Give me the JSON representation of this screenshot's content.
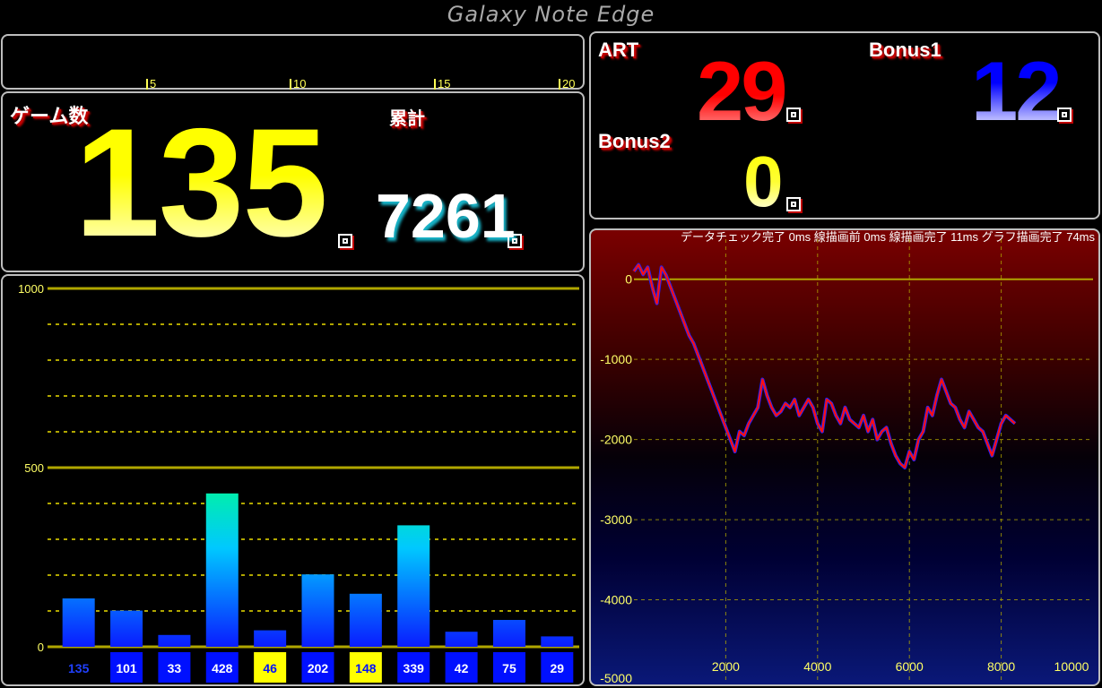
{
  "window": {
    "title": "Galaxy Note Edge"
  },
  "ruler": {
    "ticks": [
      "5",
      "10",
      "15",
      "20"
    ]
  },
  "game": {
    "count_label": "ゲーム数",
    "count_value": "135",
    "total_label": "累計",
    "total_value": "7261",
    "unit_icon": "square-spiral-icon"
  },
  "bonus": {
    "art_label": "ART",
    "art_value": "29",
    "bonus1_label": "Bonus1",
    "bonus1_value": "12",
    "bonus2_label": "Bonus2",
    "bonus2_value": "0"
  },
  "status": {
    "text": "データチェック完了 0ms  線描画前 0ms  線描画完了 11ms  グラフ描画完了 74ms"
  },
  "colors": {
    "blue_bar": "#0a32ff",
    "yellow_bar": "#ffff00",
    "grid": "#b0a600",
    "line_red": "#ff1010",
    "line_blue": "#1a20ff",
    "label_red": "#c00000"
  },
  "chart_data": [
    {
      "type": "bar",
      "categories": [
        "135",
        "101",
        "33",
        "428",
        "46",
        "202",
        "148",
        "339",
        "42",
        "75",
        "29"
      ],
      "values": [
        135,
        101,
        33,
        428,
        46,
        202,
        148,
        339,
        42,
        75,
        29
      ],
      "highlight": [
        false,
        false,
        false,
        false,
        true,
        false,
        true,
        false,
        false,
        false,
        false
      ],
      "yticks": [
        "0",
        "500",
        "1000"
      ],
      "ylim": [
        0,
        1000
      ],
      "grid": true
    },
    {
      "type": "line",
      "x": [
        0,
        100,
        200,
        300,
        400,
        500,
        600,
        700,
        800,
        900,
        1000,
        1100,
        1200,
        1300,
        1400,
        1500,
        1600,
        1700,
        1800,
        1900,
        2000,
        2100,
        2200,
        2300,
        2400,
        2500,
        2600,
        2700,
        2800,
        2900,
        3000,
        3100,
        3200,
        3300,
        3400,
        3500,
        3600,
        3700,
        3800,
        3900,
        4000,
        4100,
        4200,
        4300,
        4400,
        4500,
        4600,
        4700,
        4800,
        4900,
        5000,
        5100,
        5200,
        5300,
        5400,
        5500,
        5600,
        5700,
        5800,
        5900,
        6000,
        6100,
        6200,
        6300,
        6400,
        6500,
        6600,
        6700,
        6800,
        6900,
        7000,
        7100,
        7200,
        7300,
        7400,
        7500,
        7600,
        7700,
        7800,
        7900,
        8000,
        8100,
        8200,
        8300
      ],
      "y": [
        100,
        180,
        60,
        150,
        -100,
        -300,
        150,
        50,
        -100,
        -250,
        -400,
        -550,
        -700,
        -800,
        -950,
        -1100,
        -1250,
        -1400,
        -1550,
        -1700,
        -1850,
        -2000,
        -2150,
        -1900,
        -1950,
        -1800,
        -1700,
        -1600,
        -1250,
        -1450,
        -1600,
        -1700,
        -1650,
        -1550,
        -1600,
        -1500,
        -1700,
        -1600,
        -1500,
        -1600,
        -1800,
        -1900,
        -1500,
        -1550,
        -1700,
        -1800,
        -1600,
        -1750,
        -1800,
        -1850,
        -1700,
        -1900,
        -1750,
        -2000,
        -1900,
        -1850,
        -2050,
        -2200,
        -2300,
        -2350,
        -2150,
        -2250,
        -2000,
        -1900,
        -1600,
        -1700,
        -1450,
        -1250,
        -1400,
        -1550,
        -1600,
        -1750,
        -1850,
        -1650,
        -1750,
        -1850,
        -1900,
        -2050,
        -2200,
        -2000,
        -1800,
        -1700,
        -1750,
        -1800
      ],
      "xticks": [
        "2000",
        "4000",
        "6000",
        "8000",
        "10000"
      ],
      "yticks": [
        "0",
        "-1000",
        "-2000",
        "-3000",
        "-4000",
        "-5000"
      ],
      "xlim": [
        0,
        10000
      ],
      "ylim": [
        -5000,
        500
      ],
      "grid": true
    }
  ]
}
